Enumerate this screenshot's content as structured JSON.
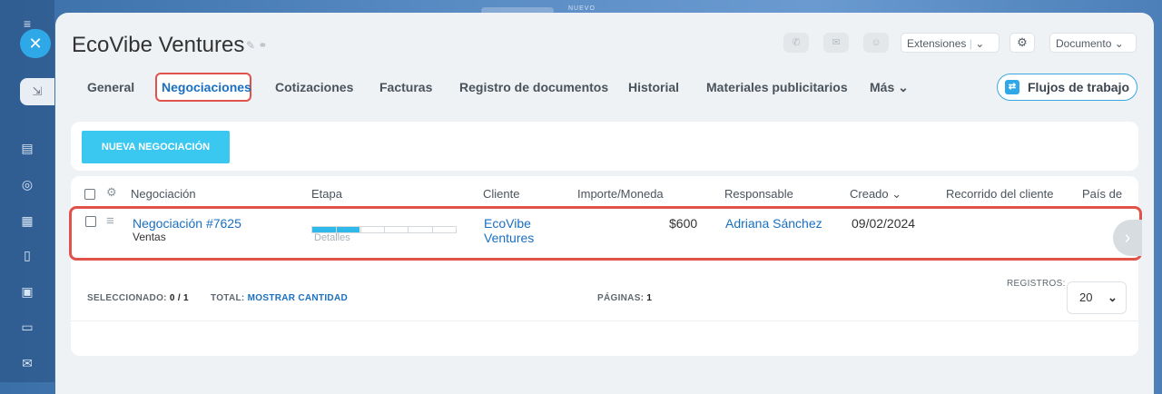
{
  "app": {
    "top_badge": "NUEVO"
  },
  "header": {
    "title": "EcoVibe Ventures",
    "extensions_label": "Extensiones",
    "document_label": "Documento"
  },
  "tabs": [
    {
      "label": "General",
      "active": false
    },
    {
      "label": "Negociaciones",
      "active": true
    },
    {
      "label": "Cotizaciones",
      "active": false
    },
    {
      "label": "Facturas",
      "active": false
    },
    {
      "label": "Registro de documentos",
      "active": false
    },
    {
      "label": "Historial",
      "active": false
    },
    {
      "label": "Materiales publicitarios",
      "active": false
    },
    {
      "label": "Más",
      "active": false
    }
  ],
  "flows_button": "Flujos de trabajo",
  "toolbar": {
    "new_deal": "NUEVA NEGOCIACIÓN"
  },
  "table": {
    "columns": [
      "Negociación",
      "Etapa",
      "Cliente",
      "Importe/Moneda",
      "Responsable",
      "Creado",
      "Recorrido del cliente",
      "País de"
    ],
    "sort_indicator": "⌄",
    "rows": [
      {
        "deal": "Negociación #7625",
        "pipeline": "Ventas",
        "stage_label": "Detalles",
        "stage_progress": 0.33,
        "client": "EcoVibe Ventures",
        "client_line1": "EcoVibe",
        "client_line2": "Ventures",
        "amount": "$600",
        "responsible": "Adriana Sánchez",
        "created": "09/02/2024"
      }
    ]
  },
  "footer": {
    "selected_label": "SELECCIONADO:",
    "selected_value": "0 / 1",
    "total_label": "TOTAL:",
    "total_link": "MOSTRAR CANTIDAD",
    "pages_label": "PÁGINAS:",
    "pages_value": "1",
    "records_label": "REGISTROS:",
    "records_value": "20"
  },
  "colors": {
    "accent": "#1a6fc0",
    "highlight": "#e0524a",
    "primary_button": "#3bc8f0"
  }
}
